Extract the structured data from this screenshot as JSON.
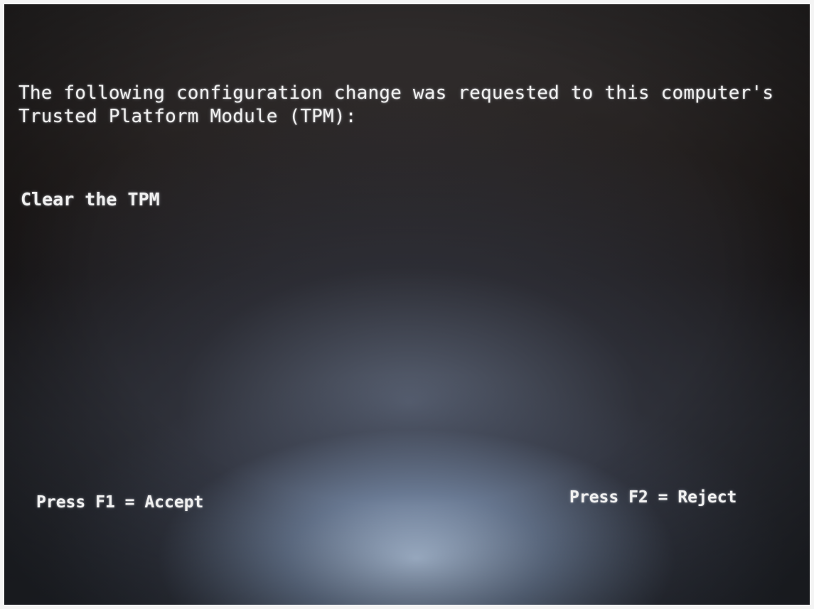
{
  "message": {
    "line1": "The following configuration change was requested to this computer's",
    "line2": "Trusted Platform Module (TPM):"
  },
  "requested_action": "Clear the TPM",
  "prompts": {
    "accept": "Press F1 = Accept",
    "reject": "Press F2 = Reject"
  },
  "colors": {
    "text": "#f0f0f0",
    "background": "#1a1616"
  }
}
